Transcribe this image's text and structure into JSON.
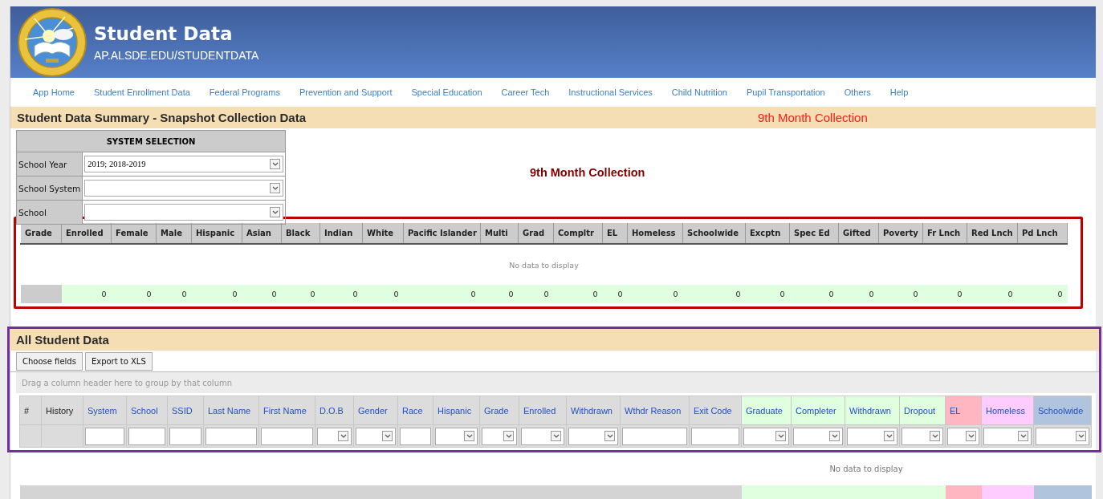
{
  "header": {
    "title": "Student Data",
    "subtitle": "AP.ALSDE.EDU/STUDENTDATA"
  },
  "nav": [
    "App Home",
    "Student Enrollment Data",
    "Federal Programs",
    "Prevention and Support",
    "Special Education",
    "Career Tech",
    "Instructional Services",
    "Child Nutrition",
    "Pupil Transportation",
    "Others",
    "Help"
  ],
  "summary_bar": {
    "title": "Student Data Summary - Snapshot Collection Data",
    "collection": "9th Month Collection"
  },
  "system_selection": {
    "title": "SYSTEM SELECTION",
    "fields": [
      {
        "label": "School Year",
        "value": "2019; 2018-2019"
      },
      {
        "label": "School System"
      },
      {
        "label": "School"
      }
    ]
  },
  "collection_heading": "9th Month Collection",
  "summary_grid": {
    "columns": [
      "Grade",
      "Enrolled",
      "Female",
      "Male",
      "Hispanic",
      "Asian",
      "Black",
      "Indian",
      "White",
      "Pacific Islander",
      "Multi",
      "Grad",
      "Compltr",
      "EL",
      "Homeless",
      "Schoolwide",
      "Excptn",
      "Spec Ed",
      "Gifted",
      "Poverty",
      "Fr Lnch",
      "Red Lnch",
      "Pd Lnch"
    ],
    "empty_text": "No data to display",
    "totals": [
      "0",
      "0",
      "0",
      "0",
      "0",
      "0",
      "0",
      "0",
      "0",
      "0",
      "0",
      "0",
      "0",
      "0",
      "0",
      "0",
      "0",
      "0",
      "0",
      "0",
      "0",
      "0"
    ]
  },
  "student_data": {
    "title": "All Student Data",
    "buttons": [
      "Choose fields",
      "Export to XLS"
    ],
    "group_hint": "Drag a column header here to group by that column",
    "columns": [
      {
        "label": "#",
        "sortable": false,
        "kind": "none"
      },
      {
        "label": "History",
        "sortable": false,
        "kind": "none"
      },
      {
        "label": "System",
        "sortable": true,
        "kind": "text"
      },
      {
        "label": "School",
        "sortable": true,
        "kind": "text"
      },
      {
        "label": "SSID",
        "sortable": true,
        "kind": "text"
      },
      {
        "label": "Last Name",
        "sortable": true,
        "kind": "text"
      },
      {
        "label": "First Name",
        "sortable": true,
        "kind": "text"
      },
      {
        "label": "D.O.B",
        "sortable": true,
        "kind": "select"
      },
      {
        "label": "Gender",
        "sortable": true,
        "kind": "select"
      },
      {
        "label": "Race",
        "sortable": true,
        "kind": "text"
      },
      {
        "label": "Hispanic",
        "sortable": true,
        "kind": "select"
      },
      {
        "label": "Grade",
        "sortable": true,
        "kind": "select"
      },
      {
        "label": "Enrolled",
        "sortable": true,
        "kind": "select"
      },
      {
        "label": "Withdrawn",
        "sortable": true,
        "kind": "select"
      },
      {
        "label": "Wthdr Reason",
        "sortable": true,
        "kind": "text"
      },
      {
        "label": "Exit Code",
        "sortable": true,
        "kind": "text"
      },
      {
        "label": "Graduate",
        "sortable": true,
        "kind": "select",
        "color": "#dfffdf"
      },
      {
        "label": "Completer",
        "sortable": true,
        "kind": "select",
        "color": "#dfffdf"
      },
      {
        "label": "Withdrawn",
        "sortable": true,
        "kind": "select",
        "color": "#dfffdf"
      },
      {
        "label": "Dropout",
        "sortable": true,
        "kind": "select",
        "color": "#dfffdf"
      },
      {
        "label": "EL",
        "sortable": true,
        "kind": "select",
        "color": "#ffb6c1"
      },
      {
        "label": "Homeless",
        "sortable": true,
        "kind": "select",
        "color": "#ffccff"
      },
      {
        "label": "Schoolwide",
        "sortable": true,
        "kind": "select",
        "color": "#b0c4de"
      }
    ],
    "empty_text": "No data to display"
  }
}
